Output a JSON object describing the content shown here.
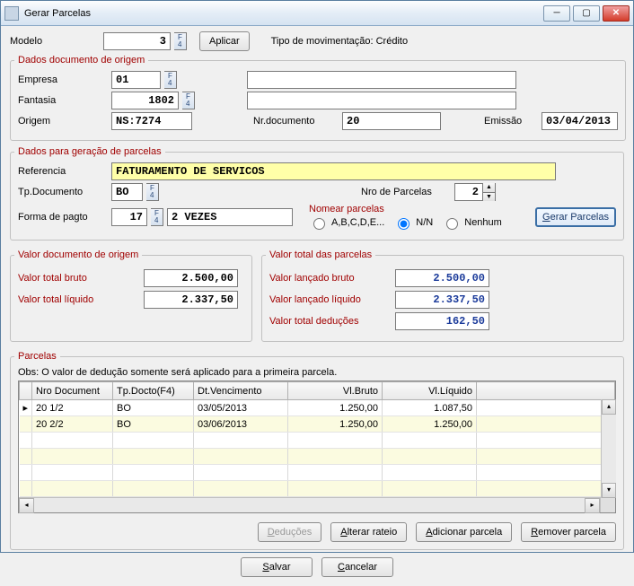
{
  "window": {
    "title": "Gerar Parcelas"
  },
  "top": {
    "modelo_label": "Modelo",
    "modelo_value": "3",
    "aplicar_label": "Aplicar",
    "tipo_mov": "Tipo de movimentação: Crédito"
  },
  "origem": {
    "legend": "Dados documento de origem",
    "empresa_label": "Empresa",
    "empresa_value": "01",
    "empresa_nome": "",
    "fantasia_label": "Fantasia",
    "fantasia_value": "1802",
    "fantasia_nome": "",
    "origem_label": "Origem",
    "origem_value": "NS:7274",
    "nrdoc_label": "Nr.documento",
    "nrdoc_value": "20",
    "emissao_label": "Emissão",
    "emissao_value": "03/04/2013"
  },
  "geracao": {
    "legend": "Dados para geração de parcelas",
    "referencia_label": "Referencia",
    "referencia_value": "FATURAMENTO DE SERVICOS",
    "tpdoc_label": "Tp.Documento",
    "tpdoc_value": "BO",
    "nroparcelas_label": "Nro de Parcelas",
    "nroparcelas_value": "2",
    "formapagto_label": "Forma de pagto",
    "formapagto_value": "17",
    "formapagto_nome": "2 VEZES",
    "nomear_label": "Nomear parcelas",
    "rb_abc": "A,B,C,D,E...",
    "rb_nn": "N/N",
    "rb_nenhum": "Nenhum",
    "gerar_btn": "Gerar Parcelas"
  },
  "valores_origem": {
    "legend": "Valor documento de origem",
    "bruto_label": "Valor total bruto",
    "bruto_value": "2.500,00",
    "liquido_label": "Valor total líquido",
    "liquido_value": "2.337,50"
  },
  "valores_parcelas": {
    "legend": "Valor total das parcelas",
    "lanc_bruto_label": "Valor lançado bruto",
    "lanc_bruto_value": "2.500,00",
    "lanc_liquido_label": "Valor lançado líquido",
    "lanc_liquido_value": "2.337,50",
    "deducoes_label": "Valor total deduções",
    "deducoes_value": "162,50"
  },
  "parcelas": {
    "legend": "Parcelas",
    "obs": "Obs: O valor de dedução somente será aplicado para a primeira parcela.",
    "headers": [
      "Nro Document",
      "Tp.Docto(F4)",
      "Dt.Vencimento",
      "Vl.Bruto",
      "Vl.Líquido"
    ],
    "rows": [
      {
        "nro": "20 1/2",
        "tp": "BO",
        "venc": "03/05/2013",
        "bruto": "1.250,00",
        "liq": "1.087,50"
      },
      {
        "nro": "20 2/2",
        "tp": "BO",
        "venc": "03/06/2013",
        "bruto": "1.250,00",
        "liq": "1.250,00"
      }
    ],
    "deducoes_btn": "Deduções",
    "alterar_btn": "Alterar rateio",
    "adicionar_btn": "Adicionar parcela",
    "remover_btn": "Remover parcela"
  },
  "footer": {
    "salvar": "Salvar",
    "cancelar": "Cancelar"
  }
}
